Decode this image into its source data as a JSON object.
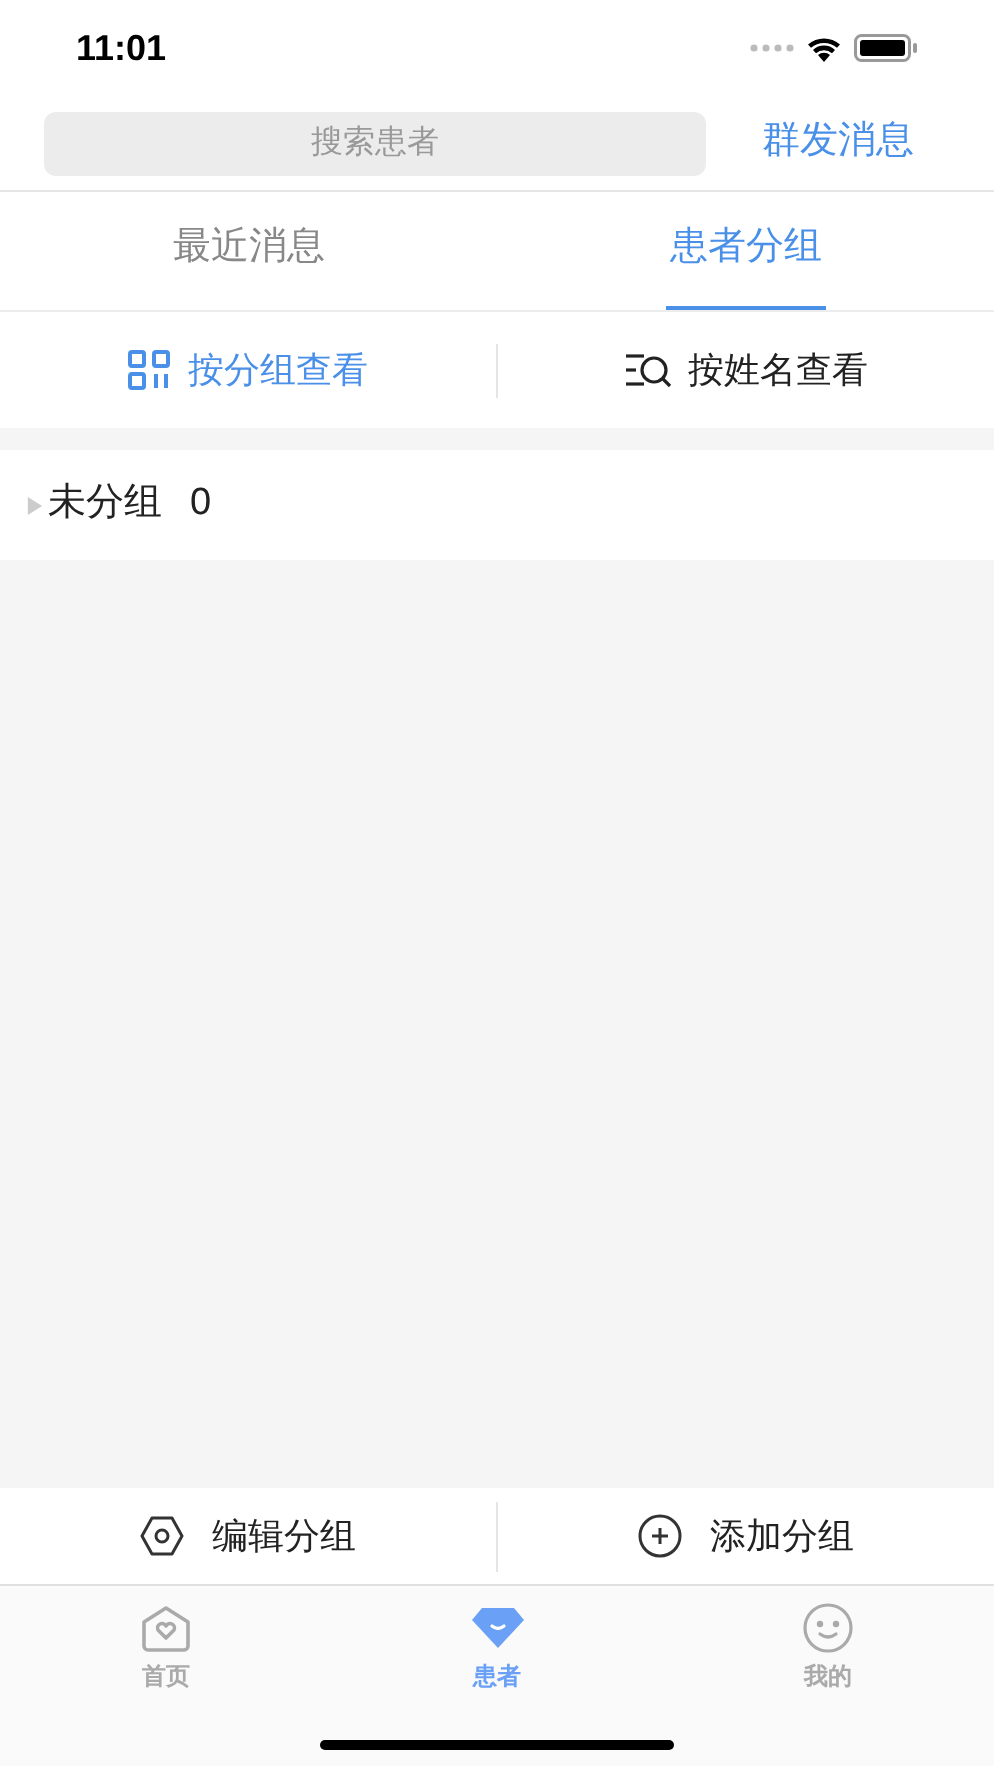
{
  "status_bar": {
    "time": "11:01"
  },
  "search": {
    "placeholder": "搜索患者"
  },
  "broadcast_button": "群发消息",
  "tabs": [
    {
      "label": "最近消息",
      "selected": false
    },
    {
      "label": "患者分组",
      "selected": true
    }
  ],
  "view_modes": [
    {
      "kind": "grid",
      "label": "按分组查看",
      "selected": true
    },
    {
      "kind": "name",
      "label": "按姓名查看",
      "selected": false
    }
  ],
  "groups": [
    {
      "name": "未分组",
      "count": "0",
      "expanded": false
    }
  ],
  "actions": [
    {
      "kind": "edit",
      "label": "编辑分组"
    },
    {
      "kind": "add",
      "label": "添加分组"
    }
  ],
  "tab_bar": [
    {
      "kind": "home",
      "label": "首页",
      "selected": false
    },
    {
      "kind": "patients",
      "label": "患者",
      "selected": true
    },
    {
      "kind": "me",
      "label": "我的",
      "selected": false
    }
  ]
}
